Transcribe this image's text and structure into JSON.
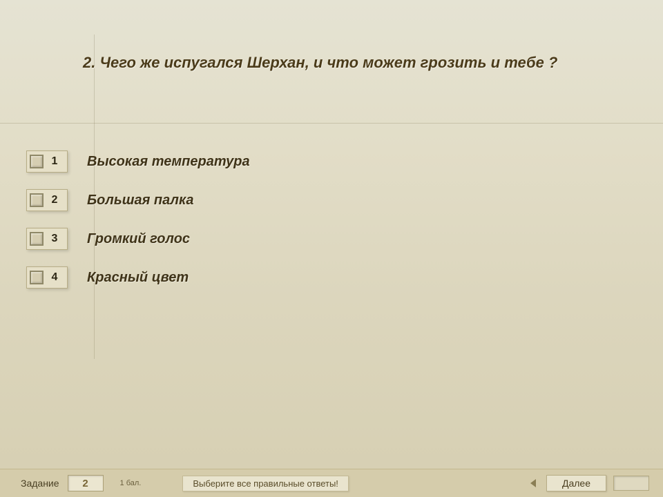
{
  "question": "2. Чего же испугался Шерхан, и что может грозить и тебе ?",
  "answers": [
    {
      "num": "1",
      "text": "Высокая температура"
    },
    {
      "num": "2",
      "text": "Большая палка"
    },
    {
      "num": "3",
      "text": "Громкий голос"
    },
    {
      "num": "4",
      "text": "Красный цвет"
    }
  ],
  "footer": {
    "task_label": "Задание",
    "task_number": "2",
    "points": "1 бал.",
    "hint": "Выберите все правильные ответы!",
    "next": "Далее"
  }
}
